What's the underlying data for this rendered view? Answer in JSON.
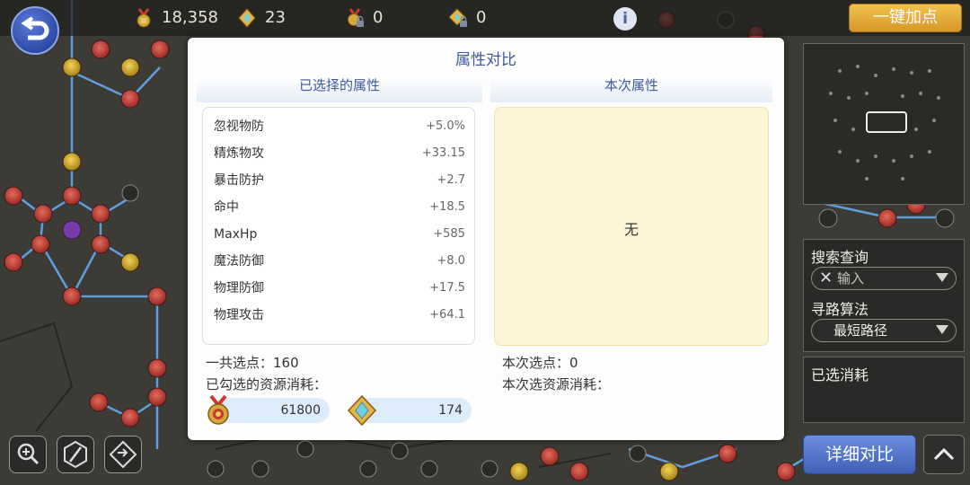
{
  "topbar": {
    "back_icon": "back-arrow-icon",
    "resources": [
      {
        "icon": "medal-icon",
        "value": "18,358"
      },
      {
        "icon": "crystal-icon",
        "value": "23"
      },
      {
        "icon": "locked-medal-icon",
        "value": "0"
      },
      {
        "icon": "locked-crystal-icon",
        "value": "0"
      }
    ],
    "info_icon": "info-icon",
    "auto_add_label": "一键加点"
  },
  "dialog": {
    "title": "属性对比",
    "selected_header": "已选择的属性",
    "current_header": "本次属性",
    "attributes": [
      {
        "name": "忽视物防",
        "value": "+5.0%"
      },
      {
        "name": "精炼物攻",
        "value": "+33.15"
      },
      {
        "name": "暴击防护",
        "value": "+2.7"
      },
      {
        "name": "命中",
        "value": "+18.5"
      },
      {
        "name": "MaxHp",
        "value": "+585"
      },
      {
        "name": "魔法防御",
        "value": "+8.0"
      },
      {
        "name": "物理防御",
        "value": "+17.5"
      },
      {
        "name": "物理攻击",
        "value": "+64.1"
      }
    ],
    "current_none": "无",
    "total_points": "一共选点：160",
    "selected_cost_label": "已勾选的资源消耗：",
    "costs": [
      {
        "icon": "medal-icon",
        "value": "61800"
      },
      {
        "icon": "crystal-icon",
        "value": "174"
      }
    ],
    "current_points": "本次选点：0",
    "current_cost_label": "本次选资源消耗："
  },
  "side": {
    "search_label": "搜索查询",
    "search_placeholder": "输入",
    "path_label": "寻路算法",
    "path_value": "最短路径",
    "selected_cost_label": "已选消耗",
    "detail_button": "详细对比"
  },
  "tools": [
    "zoom-in-icon",
    "edit-icon",
    "swap-icon"
  ],
  "colors": {
    "accent_blue": "#3d5aa0",
    "gold_button": "#e6ad3a",
    "panel_yellow": "#fdf6d6",
    "cost_pill": "#dcecfb"
  }
}
